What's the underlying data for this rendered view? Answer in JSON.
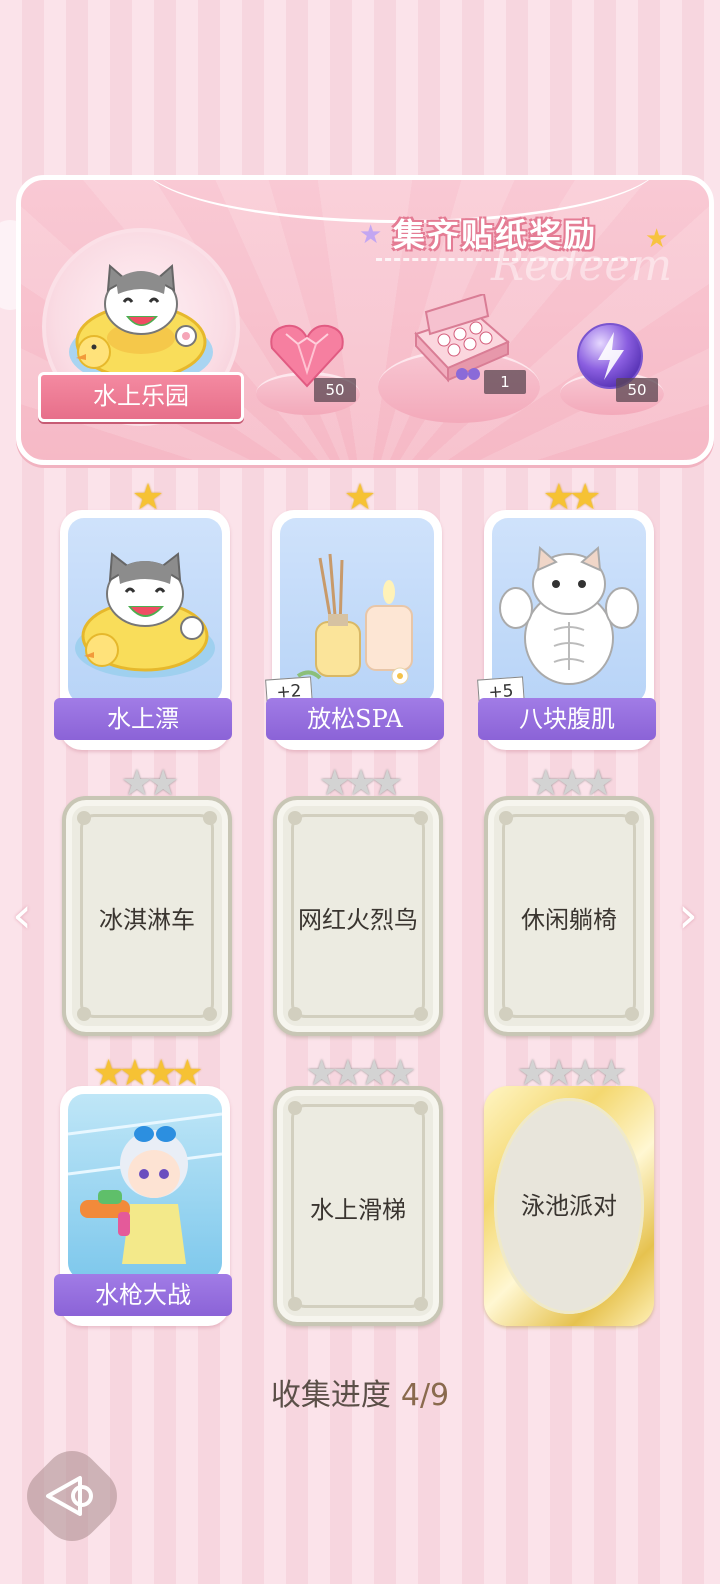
{
  "banner": {
    "title": "集齐贴纸奖励",
    "watermark": "Redeem",
    "album_name": "水上乐园",
    "rewards": [
      {
        "icon": "pink-heart-gem-icon",
        "count": "50"
      },
      {
        "icon": "gift-box-icon",
        "count": "1"
      },
      {
        "icon": "purple-energy-orb-icon",
        "count": "50"
      }
    ]
  },
  "cards": [
    {
      "name": "水上漂",
      "stars": 1,
      "max_stars": 1,
      "collected": true,
      "plus": ""
    },
    {
      "name": "放松SPA",
      "stars": 1,
      "max_stars": 1,
      "collected": true,
      "plus": "+2"
    },
    {
      "name": "八块腹肌",
      "stars": 2,
      "max_stars": 2,
      "collected": true,
      "plus": "+5"
    },
    {
      "name": "冰淇淋车",
      "stars": 0,
      "max_stars": 2,
      "collected": false
    },
    {
      "name": "网红火烈鸟",
      "stars": 0,
      "max_stars": 3,
      "collected": false
    },
    {
      "name": "休闲躺椅",
      "stars": 0,
      "max_stars": 3,
      "collected": false
    },
    {
      "name": "水枪大战",
      "stars": 4,
      "max_stars": 4,
      "collected": true,
      "plus": ""
    },
    {
      "name": "水上滑梯",
      "stars": 0,
      "max_stars": 4,
      "collected": false
    },
    {
      "name": "泳池派对",
      "stars": 0,
      "max_stars": 4,
      "collected": false,
      "gold": true
    }
  ],
  "progress": {
    "label": "收集进度",
    "value": "4/9"
  },
  "colors": {
    "accent_pink": "#e76f8a",
    "label_purple": "#8b63d7",
    "star_gold": "#f6c234"
  }
}
